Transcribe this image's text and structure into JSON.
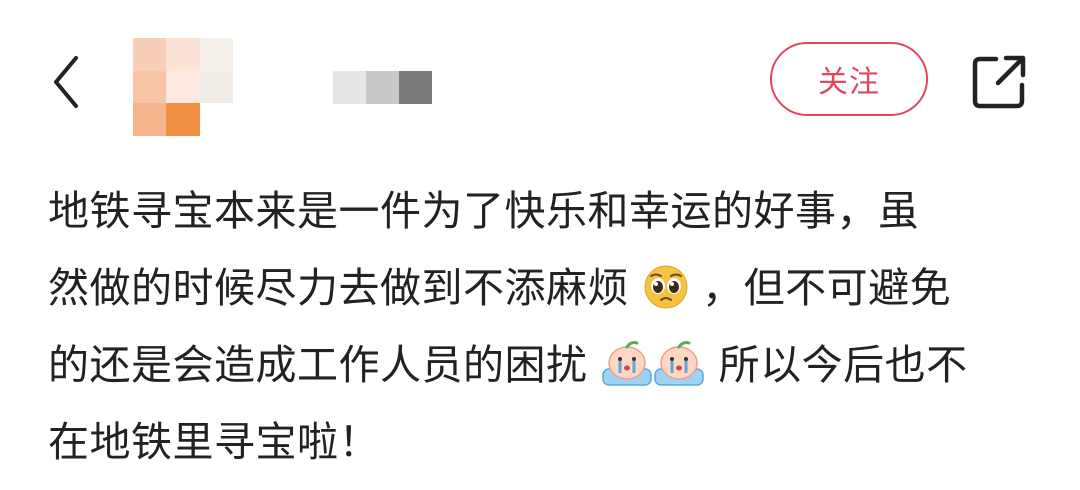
{
  "header": {
    "follow_label": "关注",
    "back_icon": "chevron-left-icon",
    "share_icon": "share-external-icon"
  },
  "post": {
    "line1": "地铁寻宝本来是一件为了快乐和幸运的好事，虽",
    "line2_a": "然做的时候尽力去做到不添麻烦",
    "line2_b": "，但不可避免",
    "line3_a": "的还是会造成工作人员的困扰",
    "line3_b": "所以今后也不",
    "line4": "在地铁里寻宝啦！"
  },
  "colors": {
    "accent": "#e0485d",
    "text": "#222222"
  }
}
